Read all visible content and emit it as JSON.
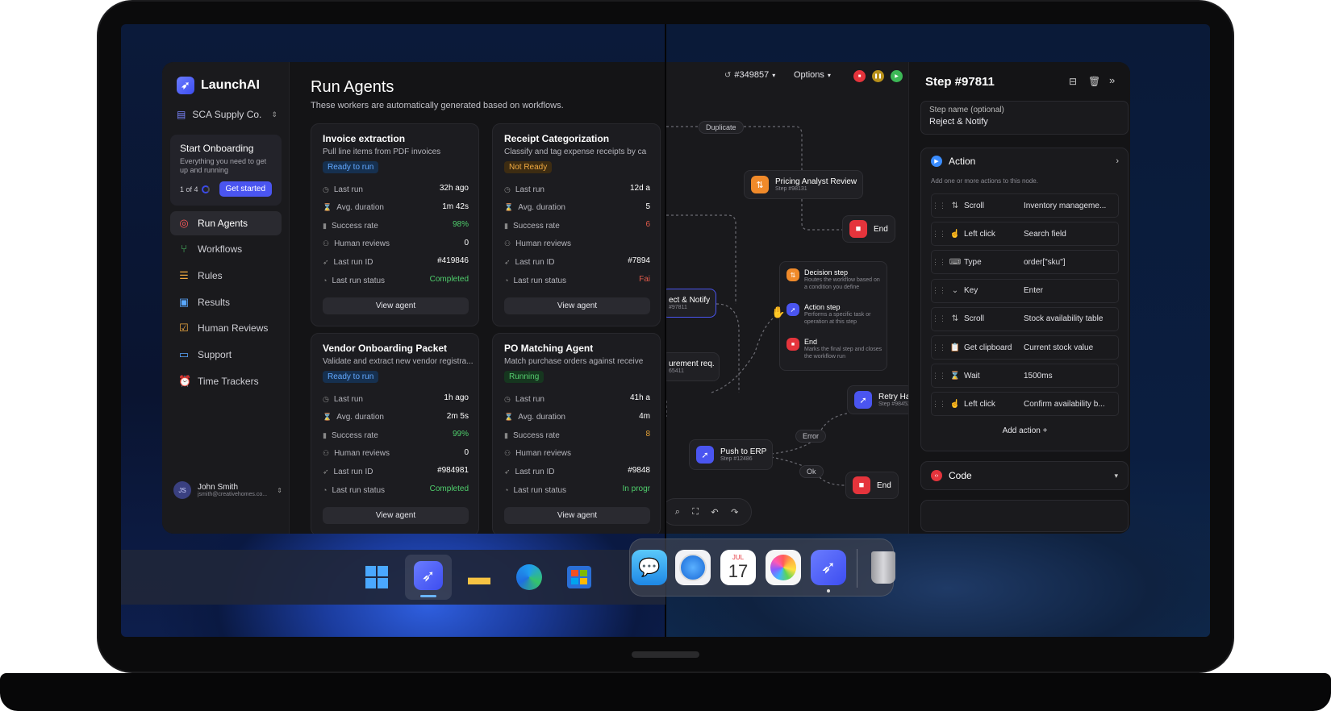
{
  "app": {
    "name": "LaunchAI",
    "org": "SCA Supply Co."
  },
  "onboarding": {
    "title": "Start Onboarding",
    "desc": "Everything you need to get up and running",
    "progress": "1 of 4",
    "cta": "Get started"
  },
  "nav": [
    {
      "label": "Run Agents",
      "icon": "run-agents-icon",
      "active": true
    },
    {
      "label": "Workflows",
      "icon": "workflows-icon",
      "active": false
    },
    {
      "label": "Rules",
      "icon": "rules-icon",
      "active": false
    },
    {
      "label": "Results",
      "icon": "results-icon",
      "active": false
    },
    {
      "label": "Human Reviews",
      "icon": "human-reviews-icon",
      "active": false
    },
    {
      "label": "Support",
      "icon": "support-icon",
      "active": false
    },
    {
      "label": "Time Trackers",
      "icon": "time-trackers-icon",
      "active": false
    }
  ],
  "user": {
    "initials": "JS",
    "name": "John Smith",
    "email": "jsmith@creativehomes.co..."
  },
  "page": {
    "title": "Run Agents",
    "subtitle": "These workers are automatically generated based on workflows."
  },
  "labels": {
    "last_run": "Last run",
    "avg_duration": "Avg. duration",
    "success_rate": "Success rate",
    "human_reviews": "Human reviews",
    "last_run_id": "Last run ID",
    "last_run_status": "Last run status",
    "view_agent": "View agent"
  },
  "agents": [
    {
      "title": "Invoice extraction",
      "desc": "Pull line items from PDF invoices",
      "status": "Ready to run",
      "last_run": "32h ago",
      "avg_duration": "1m 42s",
      "success_rate": "98%",
      "human_reviews": "0",
      "last_run_id": "#419846",
      "last_run_status": "Completed"
    },
    {
      "title": "Receipt Categorization",
      "desc": "Classify and tag expense receipts by ca",
      "status": "Not Ready",
      "last_run": "12d a",
      "avg_duration": "5",
      "success_rate": "6",
      "human_reviews": "",
      "last_run_id": "#7894",
      "last_run_status": "Fai"
    },
    {
      "title": "Vendor Onboarding Packet",
      "desc": "Validate and extract new vendor registra...",
      "status": "Ready to run",
      "last_run": "1h ago",
      "avg_duration": "2m 5s",
      "success_rate": "99%",
      "human_reviews": "0",
      "last_run_id": "#984981",
      "last_run_status": "Completed"
    },
    {
      "title": "PO Matching Agent",
      "desc": "Match purchase orders against receive",
      "status": "Running",
      "last_run": "41h a",
      "avg_duration": "4m",
      "success_rate": "8",
      "human_reviews": "",
      "last_run_id": "#9848",
      "last_run_status": "In progr"
    }
  ],
  "toolbar": {
    "run_id": "#349857",
    "options": "Options"
  },
  "canvas": {
    "duplicate": "Duplicate",
    "pricing": {
      "title": "Pricing Analyst Review",
      "step": "Step #98131"
    },
    "end1": "End",
    "reject": {
      "title": "ect & Notify",
      "step": "#97811"
    },
    "procurement": {
      "title": "urement req.",
      "step": "65411"
    },
    "push": {
      "title": "Push to ERP",
      "step": "Step #12486"
    },
    "retry": {
      "title": "Retry Han",
      "step": "Step #98452"
    },
    "error": "Error",
    "ok": "Ok",
    "end2": "End",
    "menu": [
      {
        "title": "Decision step",
        "desc": "Routes the workflow based on a condition you define"
      },
      {
        "title": "Action step",
        "desc": "Performs a specific task or operation at this step"
      },
      {
        "title": "End",
        "desc": "Marks the final step and closes the workflow run"
      }
    ]
  },
  "panel": {
    "title": "Step #97811",
    "step_name_label": "Step name (optional)",
    "step_name_value": "Reject & Notify",
    "action_title": "Action",
    "action_hint": "Add one or more actions to this node.",
    "actions": [
      {
        "type": "Scroll",
        "icon": "scroll-icon",
        "value": "Inventory manageme..."
      },
      {
        "type": "Left click",
        "icon": "click-icon",
        "value": "Search field"
      },
      {
        "type": "Type",
        "icon": "keyboard-icon",
        "value": "order[\"sku\"]"
      },
      {
        "type": "Key",
        "icon": "key-icon",
        "value": "Enter"
      },
      {
        "type": "Scroll",
        "icon": "scroll-icon",
        "value": "Stock availability table"
      },
      {
        "type": "Get clipboard",
        "icon": "clipboard-icon",
        "value": "Current stock value"
      },
      {
        "type": "Wait",
        "icon": "hourglass-icon",
        "value": "1500ms"
      },
      {
        "type": "Left click",
        "icon": "click-icon",
        "value": "Confirm availability b..."
      }
    ],
    "add_action": "Add action +",
    "code_title": "Code"
  },
  "colors": {
    "accent": "#4a55f0",
    "success": "#4fcf6c",
    "warning": "#f0a940",
    "danger": "#e5343c"
  }
}
